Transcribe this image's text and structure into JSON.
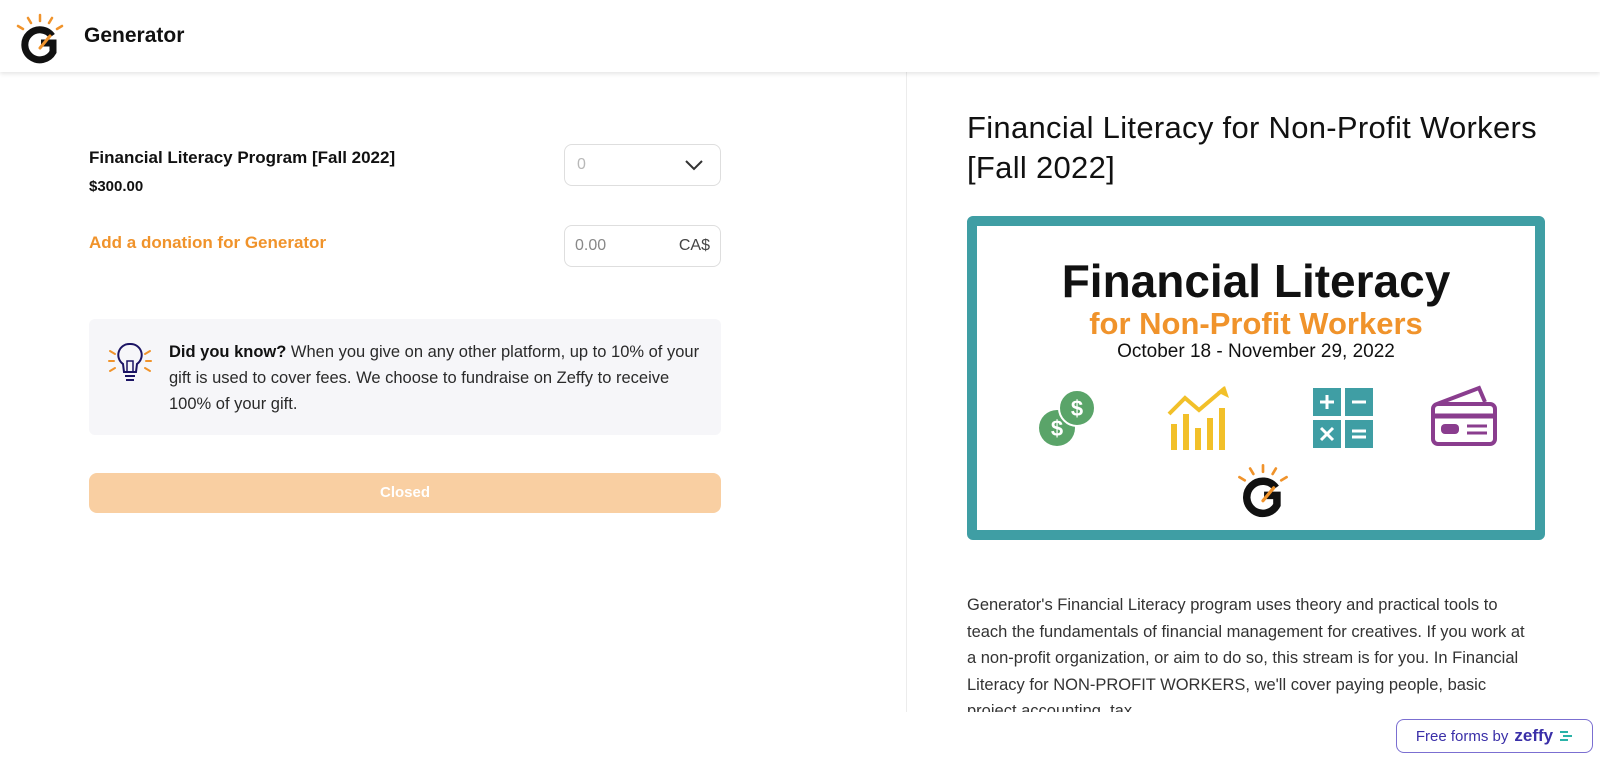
{
  "header": {
    "brand": "Generator"
  },
  "form": {
    "product_name": "Financial Literacy Program [Fall 2022]",
    "product_price": "$300.00",
    "quantity_value": "0",
    "donation_label": "Add a donation for Generator",
    "donation_placeholder": "0.00",
    "currency": "CA$",
    "info_bold": "Did you know?",
    "info_text": " When you give on any other platform, up to 10% of your gift is used to cover fees. We choose to fundraise on Zeffy to receive 100% of your gift.",
    "submit_label": "Closed"
  },
  "event": {
    "title": "Financial Literacy for Non-Profit Workers [Fall 2022]",
    "banner_title": "Financial Literacy",
    "banner_subtitle": "for Non-Profit Workers",
    "banner_dates": "October 18 - November 29, 2022",
    "banner_icons": [
      "dollar-coins-icon",
      "bar-chart-growth-icon",
      "calculator-icon",
      "credit-card-icon"
    ],
    "description": "Generator's Financial Literacy program uses theory and practical tools to teach the fundamentals of financial management for creatives. If you work at a non-profit organization, or aim to do so, this stream is for you. In Financial Literacy for NON-PROFIT WORKERS, we'll cover paying people, basic project accounting, tax"
  },
  "footer": {
    "free_forms_label": "Free forms by",
    "zeffy_brand": "zeffy"
  },
  "colors": {
    "accent": "#f0932b",
    "teal": "#3f9ea4",
    "closed_button": "#f9cfa2",
    "zeffy": "#3a2fa8"
  }
}
